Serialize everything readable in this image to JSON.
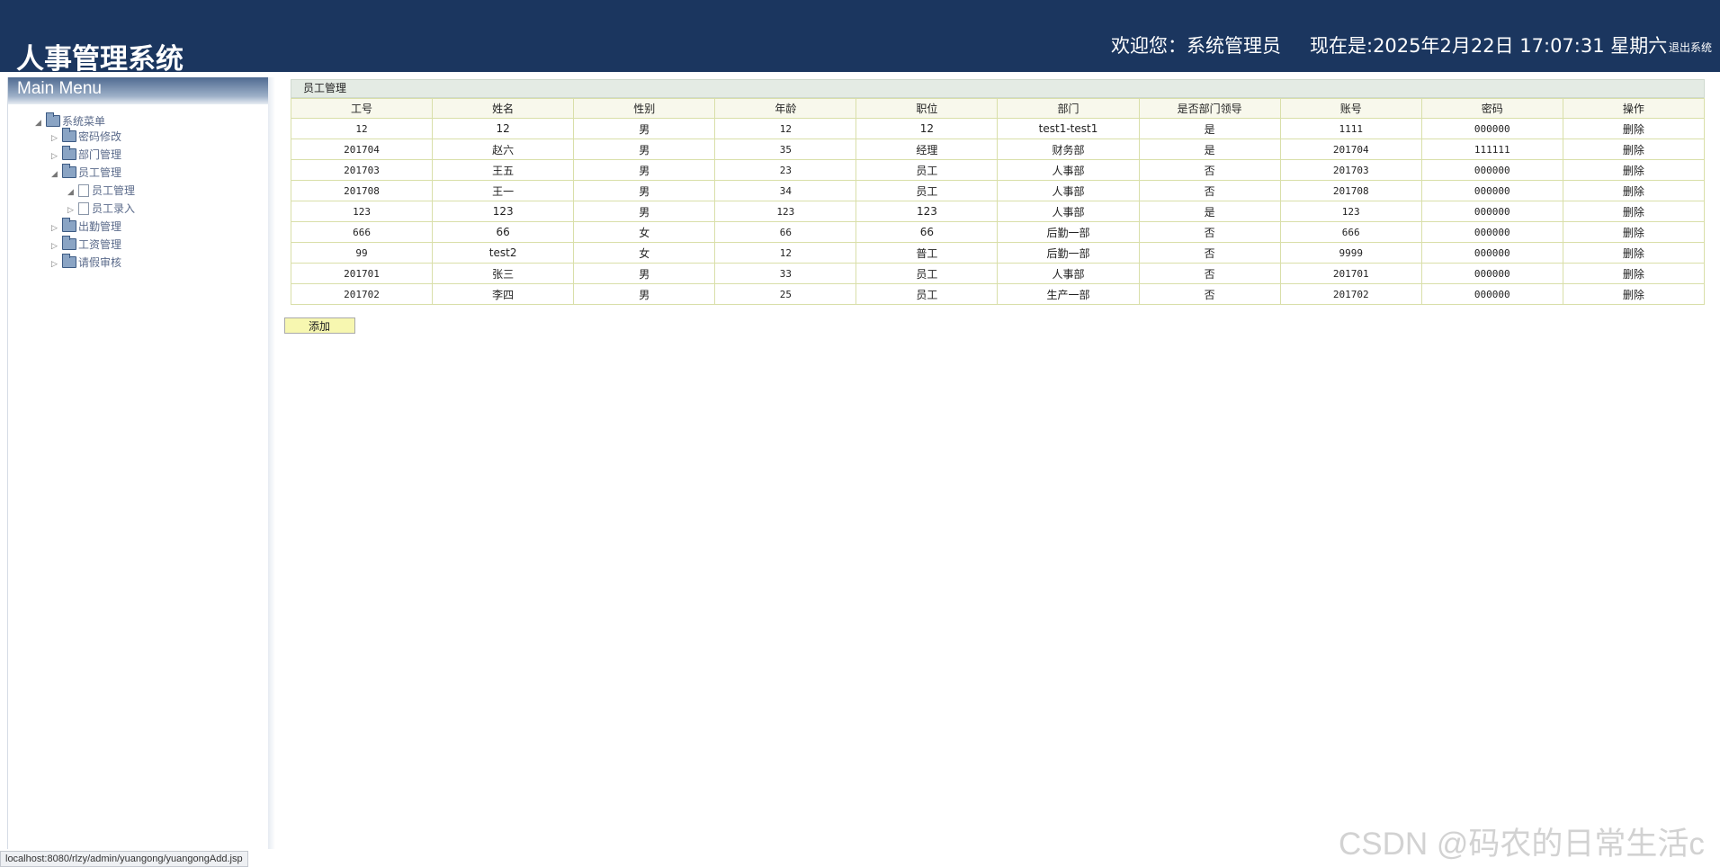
{
  "header": {
    "app_title": "人事管理系统",
    "welcome": "欢迎您：系统管理员",
    "now": "现在是:2025年2月22日 17:07:31 星期六",
    "logout": "退出系统"
  },
  "sidebar": {
    "menu_title": "Main Menu",
    "tree": {
      "root": "系统菜单",
      "password": "密码修改",
      "department": "部门管理",
      "employee": "员工管理",
      "employee_manage": "员工管理",
      "employee_entry": "员工录入",
      "attendance": "出勤管理",
      "salary": "工资管理",
      "leave": "请假审核"
    }
  },
  "main": {
    "panel_title": "员工管理",
    "columns": [
      "工号",
      "姓名",
      "性别",
      "年龄",
      "职位",
      "部门",
      "是否部门领导",
      "账号",
      "密码",
      "操作"
    ],
    "rows": [
      [
        "12",
        "12",
        "男",
        "12",
        "12",
        "test1-test1",
        "是",
        "1111",
        "000000",
        "删除"
      ],
      [
        "201704",
        "赵六",
        "男",
        "35",
        "经理",
        "财务部",
        "是",
        "201704",
        "111111",
        "删除"
      ],
      [
        "201703",
        "王五",
        "男",
        "23",
        "员工",
        "人事部",
        "否",
        "201703",
        "000000",
        "删除"
      ],
      [
        "201708",
        "王一",
        "男",
        "34",
        "员工",
        "人事部",
        "否",
        "201708",
        "000000",
        "删除"
      ],
      [
        "123",
        "123",
        "男",
        "123",
        "123",
        "人事部",
        "是",
        "123",
        "000000",
        "删除"
      ],
      [
        "666",
        "66",
        "女",
        "66",
        "66",
        "后勤一部",
        "否",
        "666",
        "000000",
        "删除"
      ],
      [
        "99",
        "test2",
        "女",
        "12",
        "普工",
        "后勤一部",
        "否",
        "9999",
        "000000",
        "删除"
      ],
      [
        "201701",
        "张三",
        "男",
        "33",
        "员工",
        "人事部",
        "否",
        "201701",
        "000000",
        "删除"
      ],
      [
        "201702",
        "李四",
        "男",
        "25",
        "员工",
        "生产一部",
        "否",
        "201702",
        "000000",
        "删除"
      ]
    ],
    "add_label": "添加"
  },
  "status_bar": "localhost:8080/rlzy/admin/yuangong/yuangongAdd.jsp",
  "watermark": "CSDN @码农的日常生活c",
  "colors": {
    "header_bg": "#1b365f",
    "table_border": "#d9dfa9",
    "add_button_bg": "#f7f7b0"
  }
}
